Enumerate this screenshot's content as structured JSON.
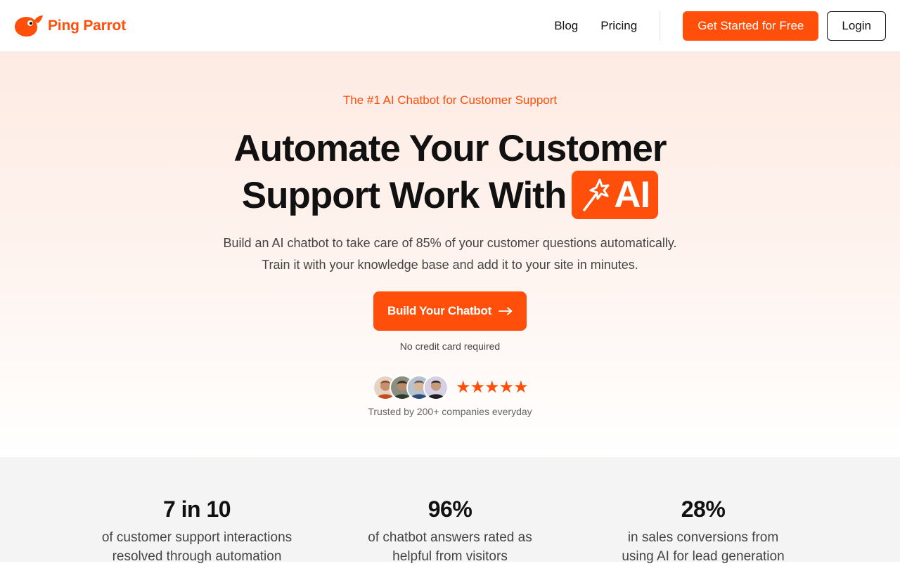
{
  "nav": {
    "brand": "Ping Parrot",
    "links": [
      "Blog",
      "Pricing"
    ],
    "cta_label": "Get Started for Free",
    "login_label": "Login"
  },
  "hero": {
    "eyebrow": "The #1 AI Chatbot for Customer Support",
    "headline_line1": "Automate Your Customer",
    "headline_line2": "Support Work With",
    "badge_text": "AI",
    "badge_icon": "magic-wand-icon",
    "subtext_line1": "Build an AI chatbot to take care of 85% of your customer questions automatically.",
    "subtext_line2": "Train it with your knowledge base and add it to your site in minutes.",
    "cta_label": "Build Your Chatbot",
    "cta_icon": "arrow-right-icon",
    "note": "No credit card required",
    "stars": "★★★★★",
    "rating": 5,
    "trusted": "Trusted by 200+ companies everyday"
  },
  "stats": [
    {
      "value": "7 in 10",
      "line1": "of customer support interactions",
      "line2": "resolved through automation"
    },
    {
      "value": "96%",
      "line1": "of chatbot answers rated as",
      "line2": "helpful from visitors"
    },
    {
      "value": "28%",
      "line1": "in sales conversions from",
      "line2": "using AI for lead generation"
    }
  ],
  "colors": {
    "accent": "#ff4f0a",
    "text": "#111111",
    "muted": "#444444",
    "stats_bg": "#f4f4f4"
  }
}
